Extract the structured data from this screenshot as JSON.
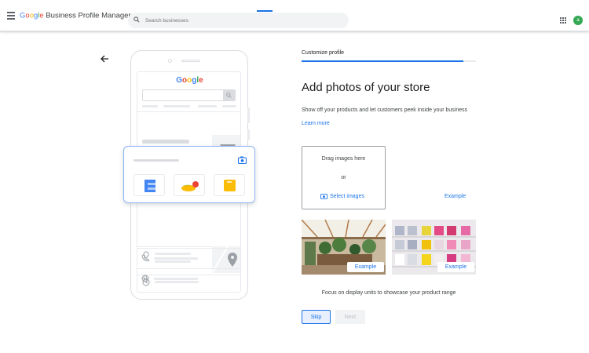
{
  "header": {
    "brand_google": "Google",
    "brand_product": "Business Profile Manager",
    "search_placeholder": "Search businesses",
    "avatar_initial": "a"
  },
  "phone_mock": {
    "logo": "Google"
  },
  "step": {
    "label": "Customize profile",
    "progress": 0.93
  },
  "main": {
    "heading": "Add photos of your store",
    "description": "Show off your products and let customers peek inside your business",
    "learn_more": "Learn more",
    "drop_text": "Drag images here",
    "or_text": "or",
    "select_images": "Select images",
    "example_link": "Example",
    "photo_examples": [
      {
        "badge": "Example"
      },
      {
        "badge": "Example"
      }
    ],
    "caption": "Focus on display units to showcase your product range"
  },
  "actions": {
    "skip": "Skip",
    "next": "Next"
  },
  "colors": {
    "accent": "#1a73e8",
    "avatar": "#34a853"
  }
}
